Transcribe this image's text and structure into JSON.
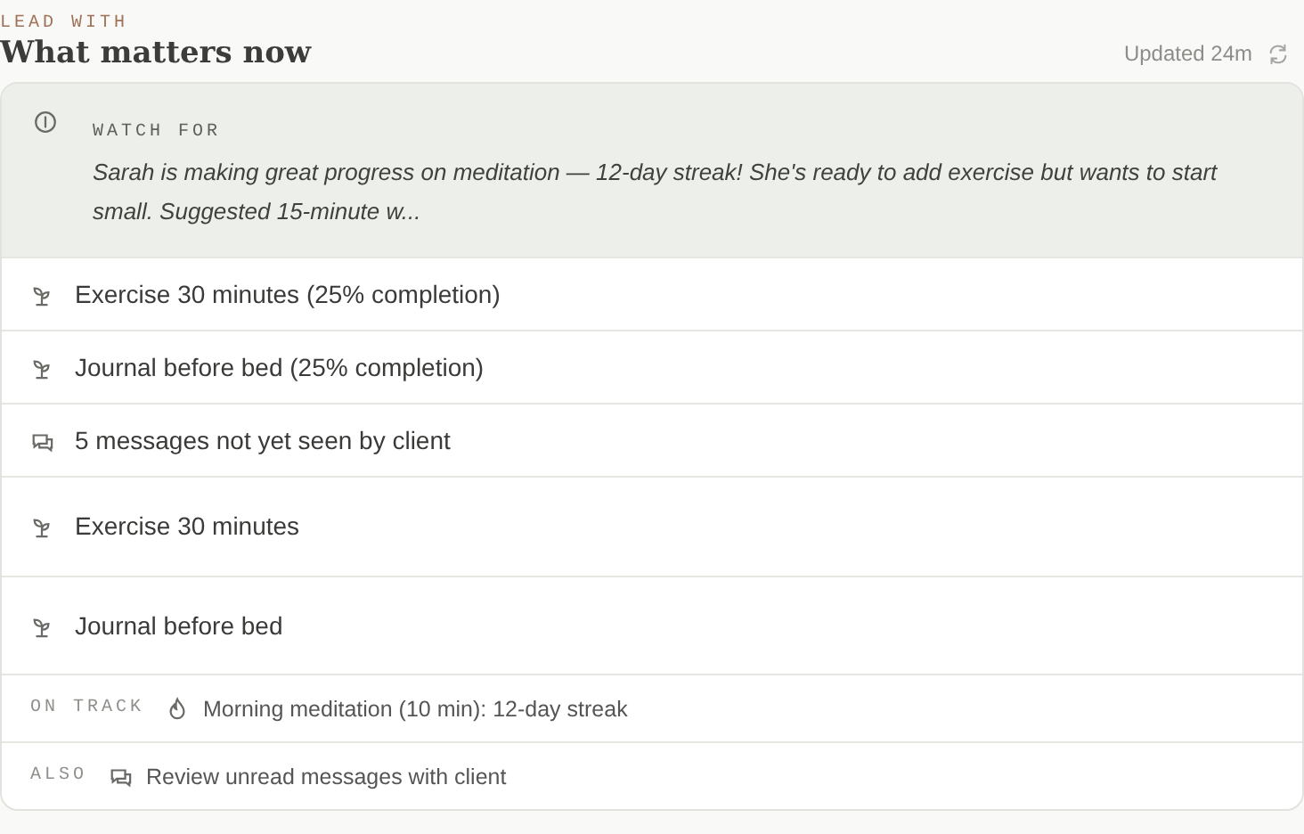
{
  "eyebrow": "LEAD WITH",
  "title": "What matters now",
  "updated": "Updated 24m",
  "watch": {
    "label": "WATCH FOR",
    "text": "Sarah is making great progress on meditation — 12-day streak! She's ready to add exercise but wants to start small. Suggested 15-minute w..."
  },
  "items": [
    {
      "kind": "sprout",
      "text": "Exercise 30 minutes (25% completion)"
    },
    {
      "kind": "sprout",
      "text": "Journal before bed (25% completion)"
    },
    {
      "kind": "messages",
      "text": "5 messages not yet seen by client"
    },
    {
      "kind": "sprout",
      "text": "Exercise 30 minutes",
      "tall": true
    },
    {
      "kind": "sprout",
      "text": "Journal before bed",
      "tall": true
    }
  ],
  "footer": [
    {
      "label": "ON TRACK",
      "kind": "flame",
      "text": "Morning meditation (10 min): 12-day streak"
    },
    {
      "label": "ALSO",
      "kind": "messages",
      "text": "Review unread messages with client"
    }
  ]
}
